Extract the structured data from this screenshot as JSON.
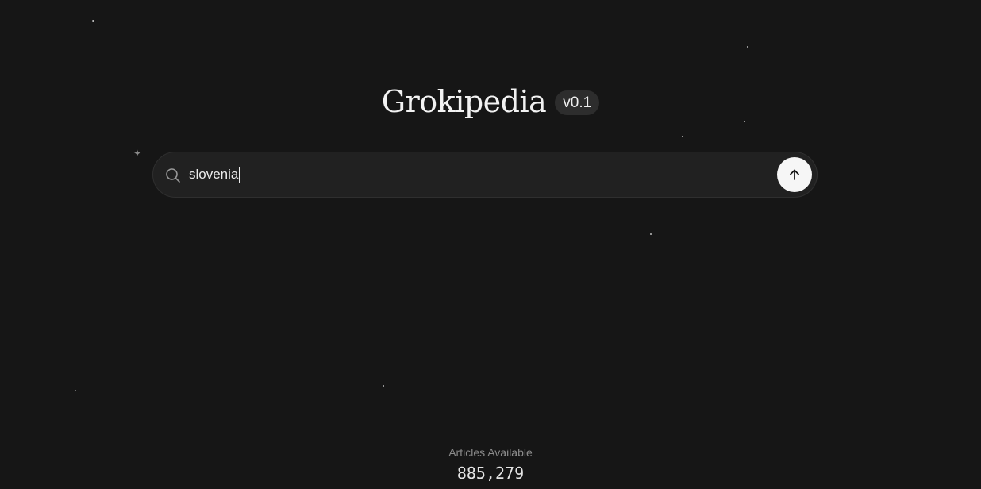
{
  "brand": {
    "title": "Grokipedia",
    "version": "v0.1"
  },
  "search": {
    "value": "slovenia",
    "icon": "search-icon",
    "submit_icon": "arrow-up-icon"
  },
  "stats": {
    "label": "Articles Available",
    "value": "885,279"
  },
  "colors": {
    "background": "#161616",
    "search_bg": "#212121",
    "submit_bg": "#f6f6f6",
    "muted_text": "#8c8c8c"
  }
}
